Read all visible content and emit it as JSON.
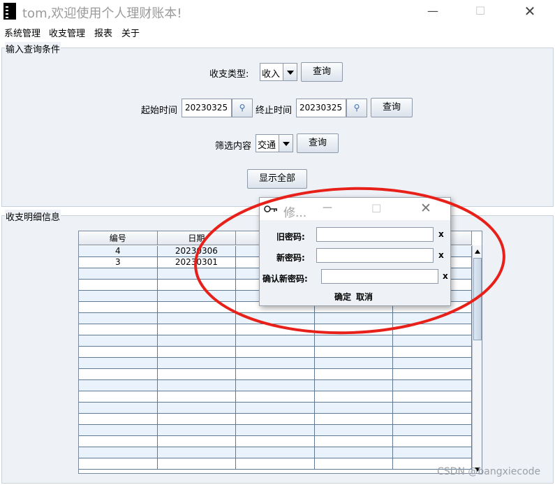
{
  "window": {
    "title": "tom,欢迎使用个人理财账本!",
    "minimize_glyph": "—",
    "maximize_glyph": "☐",
    "close_glyph": "✕"
  },
  "menu": [
    "系统管理",
    "收支管理",
    "报表",
    "关于"
  ],
  "query_panel": {
    "title": "输入查询条件",
    "type_label": "收支类型:",
    "type_value": "收入",
    "start_label": "起始时间",
    "start_value": "20230325",
    "end_label": "终止时间",
    "end_value": "20230325",
    "filter_label": "筛选内容",
    "filter_value": "交通",
    "query_button": "查询",
    "show_all_button": "显示全部"
  },
  "detail_panel": {
    "title": "收支明细信息",
    "columns": [
      "编号",
      "日期",
      "",
      "",
      ""
    ],
    "rows": [
      [
        "4",
        "20230306",
        "",
        "",
        ""
      ],
      [
        "3",
        "20230301",
        "",
        "",
        ""
      ]
    ]
  },
  "dialog": {
    "title": "修...",
    "old_pwd_label": "旧密码:",
    "new_pwd_label": "新密码:",
    "confirm_pwd_label": "确认新密码:",
    "clear_glyph": "x",
    "ok_button": "确定",
    "cancel_button": "取消"
  },
  "annotation_color": "#e8201a",
  "watermark": "CSDN @bangxiecode"
}
